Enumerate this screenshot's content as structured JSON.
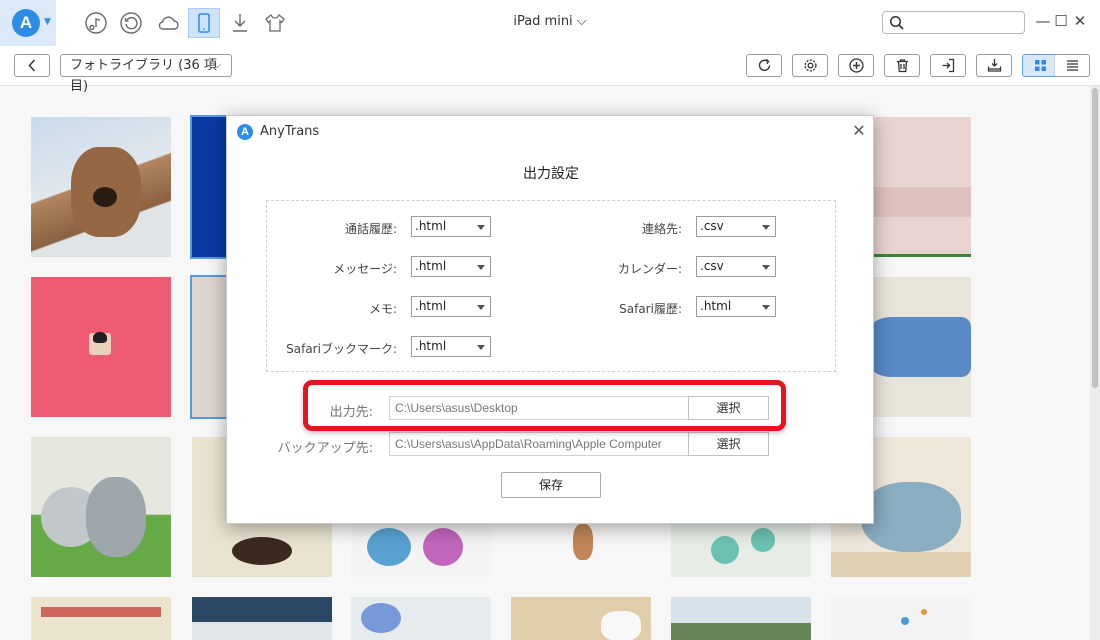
{
  "titlebar": {
    "app_logo_letter": "A",
    "device_title": "iPad mini ⌵",
    "search_placeholder": "",
    "icons": [
      "music-icon",
      "history-icon",
      "cloud-icon",
      "ipad-device-icon",
      "download-icon",
      "shirt-icon"
    ]
  },
  "toolbar": {
    "library_label": "フォトライブラリ (36 項目)",
    "buttons": [
      "refresh-icon",
      "gear-icon",
      "plus-icon",
      "trash-icon",
      "export-to-pc-icon",
      "export-to-device-icon",
      "grid-view-icon",
      "list-view-icon"
    ]
  },
  "dialog": {
    "app_name": "AnyTrans",
    "heading": "出力設定",
    "formats": {
      "call_history_label": "通話履歴:",
      "call_history_value": ".html",
      "contacts_label": "連絡先:",
      "contacts_value": ".csv",
      "messages_label": "メッセージ:",
      "messages_value": ".html",
      "calendar_label": "カレンダー:",
      "calendar_value": ".csv",
      "notes_label": "メモ:",
      "notes_value": ".html",
      "safari_history_label": "Safari履歴:",
      "safari_history_value": ".html",
      "safari_bookmarks_label": "Safariブックマーク:",
      "safari_bookmarks_value": ".html"
    },
    "output_label": "出力先:",
    "output_path": "C:\\Users\\asus\\Desktop",
    "output_button": "選択",
    "backup_label": "バックアップ先:",
    "backup_path": "C:\\Users\\asus\\AppData\\Roaming\\Apple Computer",
    "backup_button": "選択",
    "save_button": "保存",
    "highlight_color": "#e8131e"
  },
  "colors": {
    "accent": "#2d8ce8",
    "selected_bg": "#cfe3f8"
  }
}
